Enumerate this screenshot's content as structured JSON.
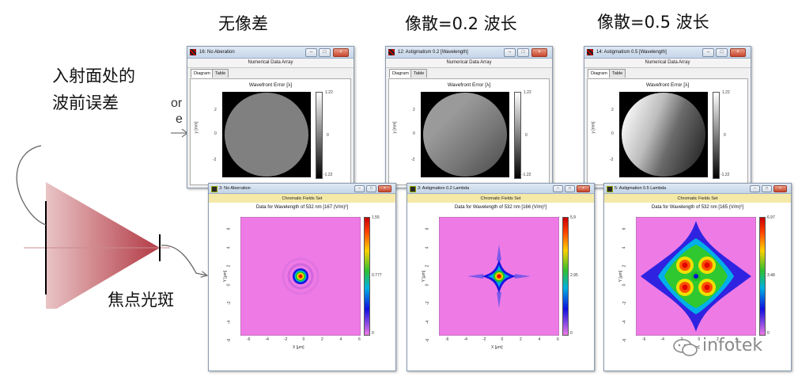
{
  "headings": {
    "no_aberration": "无像差",
    "astig_02": "像散=0.2 波长",
    "astig_05": "像散=0.5 波长"
  },
  "left_labels": {
    "wavefront_line1": "入射面处的",
    "wavefront_line2": "波前误差",
    "focus_spot": "焦点光斑"
  },
  "wavefront_windows": [
    {
      "title": "16: No Aberation",
      "subtitle": "Numerical Data Array",
      "tabs": [
        "Diagram",
        "Table"
      ],
      "plot_title": "Wavefront Error [λ]",
      "ylabel": "y [mm]",
      "yticks": [
        "2",
        "0",
        "-2"
      ],
      "cbar_max": "1.22",
      "cbar_mid": "0",
      "cbar_min": "-1.22"
    },
    {
      "title": "12: Astigmatism 0.2 [Wavelength]",
      "subtitle": "Numerical Data Array",
      "tabs": [
        "Diagram",
        "Table"
      ],
      "plot_title": "Wavefront Error [λ]",
      "ylabel": "y [mm]",
      "yticks": [
        "2",
        "0",
        "-2"
      ],
      "cbar_max": "1.22",
      "cbar_mid": "0",
      "cbar_min": "-1.22"
    },
    {
      "title": "14: Astigmatism 0.5 [Wavelength]",
      "subtitle": "Numerical Data Array",
      "tabs": [
        "Diagram",
        "Table"
      ],
      "plot_title": "Wavefront Error [λ]",
      "ylabel": "y [mm]",
      "yticks": [
        "2",
        "0",
        "-2"
      ],
      "cbar_max": "1.22",
      "cbar_mid": "0",
      "cbar_min": "-1.22"
    }
  ],
  "spot_windows": [
    {
      "title": "3: No Aberration",
      "subtitle": "Chromatic Fields Set",
      "plot_title": "Data for Wavelength of 532 nm  [167 (V/m)²]",
      "xlabel": "X [µm]",
      "ylabel": "Y [µm]",
      "ticks": [
        "-6",
        "-4",
        "-2",
        "0",
        "2",
        "4",
        "6"
      ],
      "cbar_max": "1.55",
      "cbar_mid": "0.777",
      "cbar_min": "0"
    },
    {
      "title": "3: Astigmation 0.2 Lambda",
      "subtitle": "Chromatic Fields Set",
      "plot_title": "Data for Wavelength of 532 nm  [166 (V/m)²]",
      "xlabel": "X [µm]",
      "ylabel": "Y [µm]",
      "ticks": [
        "-6",
        "-4",
        "-2",
        "0",
        "2",
        "4",
        "6"
      ],
      "cbar_max": "5.9",
      "cbar_mid": "2.95",
      "cbar_min": "0"
    },
    {
      "title": "5: Astigmation 0.5 Lambda",
      "subtitle": "Chromatic Fields Set",
      "plot_title": "Data for Wavelength of 532 nm  [165 (V/m)²]",
      "xlabel": "X [µm]",
      "ylabel": "Y [µm]",
      "ticks": [
        "-6",
        "-4",
        "-2",
        "0",
        "2",
        "4",
        "6"
      ],
      "cbar_max": "6.97",
      "cbar_mid": "3.48",
      "cbar_min": "0"
    }
  ],
  "watermark": "infotek",
  "colors": {
    "spot_background": "#ee7ae6",
    "title_bar": "#cbd9ea",
    "yellow_bar": "#f5e9a8",
    "beam": "#b43a44"
  }
}
